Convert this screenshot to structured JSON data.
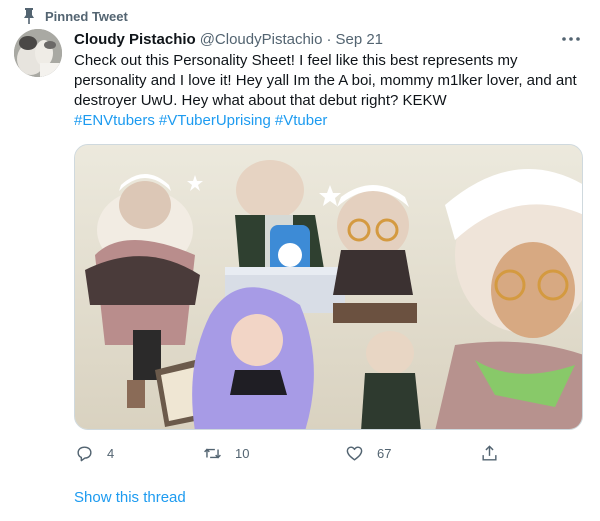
{
  "pinned": {
    "label": "Pinned Tweet",
    "icon": "pin-icon"
  },
  "author": {
    "display_name": "Cloudy Pistachio",
    "handle": "@CloudyPistachio",
    "separator": "·",
    "date": "Sep 21"
  },
  "tweet": {
    "text": "Check out this Personality Sheet! I feel like this best represents my personality and I love it! Hey yall Im the A boi, mommy m1lker lover, and ant destroyer UwU. Hey what about that debut right? KEKW",
    "hashtags": [
      "#ENVtubers",
      "#VTuberUprising",
      "#Vtuber"
    ]
  },
  "actions": {
    "reply_count": "4",
    "retweet_count": "10",
    "like_count": "67"
  },
  "show_thread": "Show this thread",
  "colors": {
    "link": "#1d9bf0",
    "secondary_text": "#536471",
    "primary_text": "#0f1419"
  }
}
